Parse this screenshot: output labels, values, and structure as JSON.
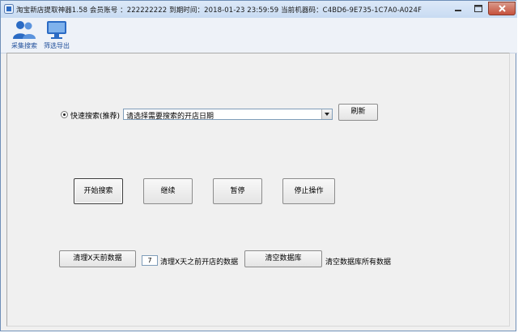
{
  "window": {
    "title": "淘宝新店提取神器1.58  会员账号 ：222222222 到期时间：2018-01-23 23:59:59 当前机器码：C4BD6-9E735-1C7A0-A024F"
  },
  "toolbar": {
    "items": [
      {
        "label": "采集搜索",
        "icon": "users-icon"
      },
      {
        "label": "筛选导出",
        "icon": "monitor-icon"
      }
    ]
  },
  "search": {
    "radio_label": "快速搜索(推荐)",
    "radio_checked": true,
    "select_value": "请选择需要搜索的开店日期",
    "refresh_label": "刷新"
  },
  "actions": {
    "start": "开始搜索",
    "continue": "继续",
    "pause": "暂停",
    "stop": "停止操作"
  },
  "cleanup": {
    "clear_days_button": "清理X天前数据",
    "days_value": "7",
    "days_description": "清理X天之前开店的数据",
    "clear_db_button": "清空数据库",
    "clear_db_description": "清空数据库所有数据"
  },
  "colors": {
    "icon_blue": "#2b6bc4",
    "toolbar_label": "#1f4e9a",
    "close_red": "#c6523d"
  }
}
